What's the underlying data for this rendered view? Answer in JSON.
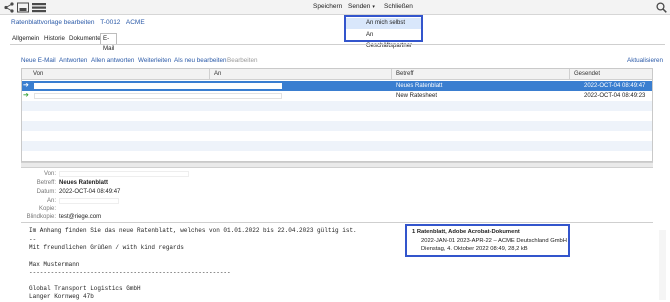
{
  "toolbar": {
    "menu": {
      "save": "Speichern",
      "send": "Senden",
      "send_caret": "▾",
      "close": "Schließen"
    },
    "icons": [
      "share-icon",
      "inbox-icon",
      "list-icon",
      "search-icon"
    ]
  },
  "send_dropdown": {
    "items": [
      "An mich selbst",
      "An Geschäftspartner"
    ]
  },
  "header": {
    "title": "Ratenblattvorlage bearbeiten",
    "code": "T-0012",
    "company": "ACME"
  },
  "tabs": [
    "Allgemein",
    "Historie",
    "Dokumente",
    "E-Mail"
  ],
  "email_actions": {
    "new": "Neue E-Mail",
    "reply": "Antworten",
    "reply_all": "Allen antworten",
    "forward": "Weiterleiten",
    "resend": "Als neu bearbeiten",
    "edit": "Bearbeiten",
    "refresh": "Aktualisieren"
  },
  "grid": {
    "columns": [
      "Von",
      "An",
      "Betreff",
      "Gesendet"
    ],
    "rows": [
      {
        "subject": "Neues Ratenblatt",
        "sent": "2022-OCT-04 08:49:47"
      },
      {
        "subject": "New Ratesheet",
        "sent": "2022-OCT-04 08:49:23"
      }
    ]
  },
  "detail": {
    "from_label": "Von:",
    "subject_label": "Betreff:",
    "subject": "Neues Ratenblatt",
    "date_label": "Datum:",
    "date": "2022-OCT-04 08:49:47",
    "to_label": "An:",
    "cc_label": "Kopie:",
    "bcc_label": "Blindkopie:",
    "bcc": "test@riege.com"
  },
  "body_lines": [
    "Im Anhang finden Sie das neue Ratenblatt, welches von 01.01.2022 bis 22.04.2023 gültig ist.",
    "--",
    "Mit freundlichen Grüßen / with kind regards",
    "",
    "Max Mustermann",
    "--------------------------------------------------------",
    "",
    "Global Transport Logistics GmbH",
    "Langer Kornweg 47b"
  ],
  "attachment": {
    "line1": "1 Ratenblatt, Adobe Acrobat-Dokument",
    "line2": "2022-JAN-01 2023-APR-22 – ACME Deutschland GmbH",
    "line3": "Dienstag, 4. Oktober 2022 08:49, 28,2 kB"
  }
}
